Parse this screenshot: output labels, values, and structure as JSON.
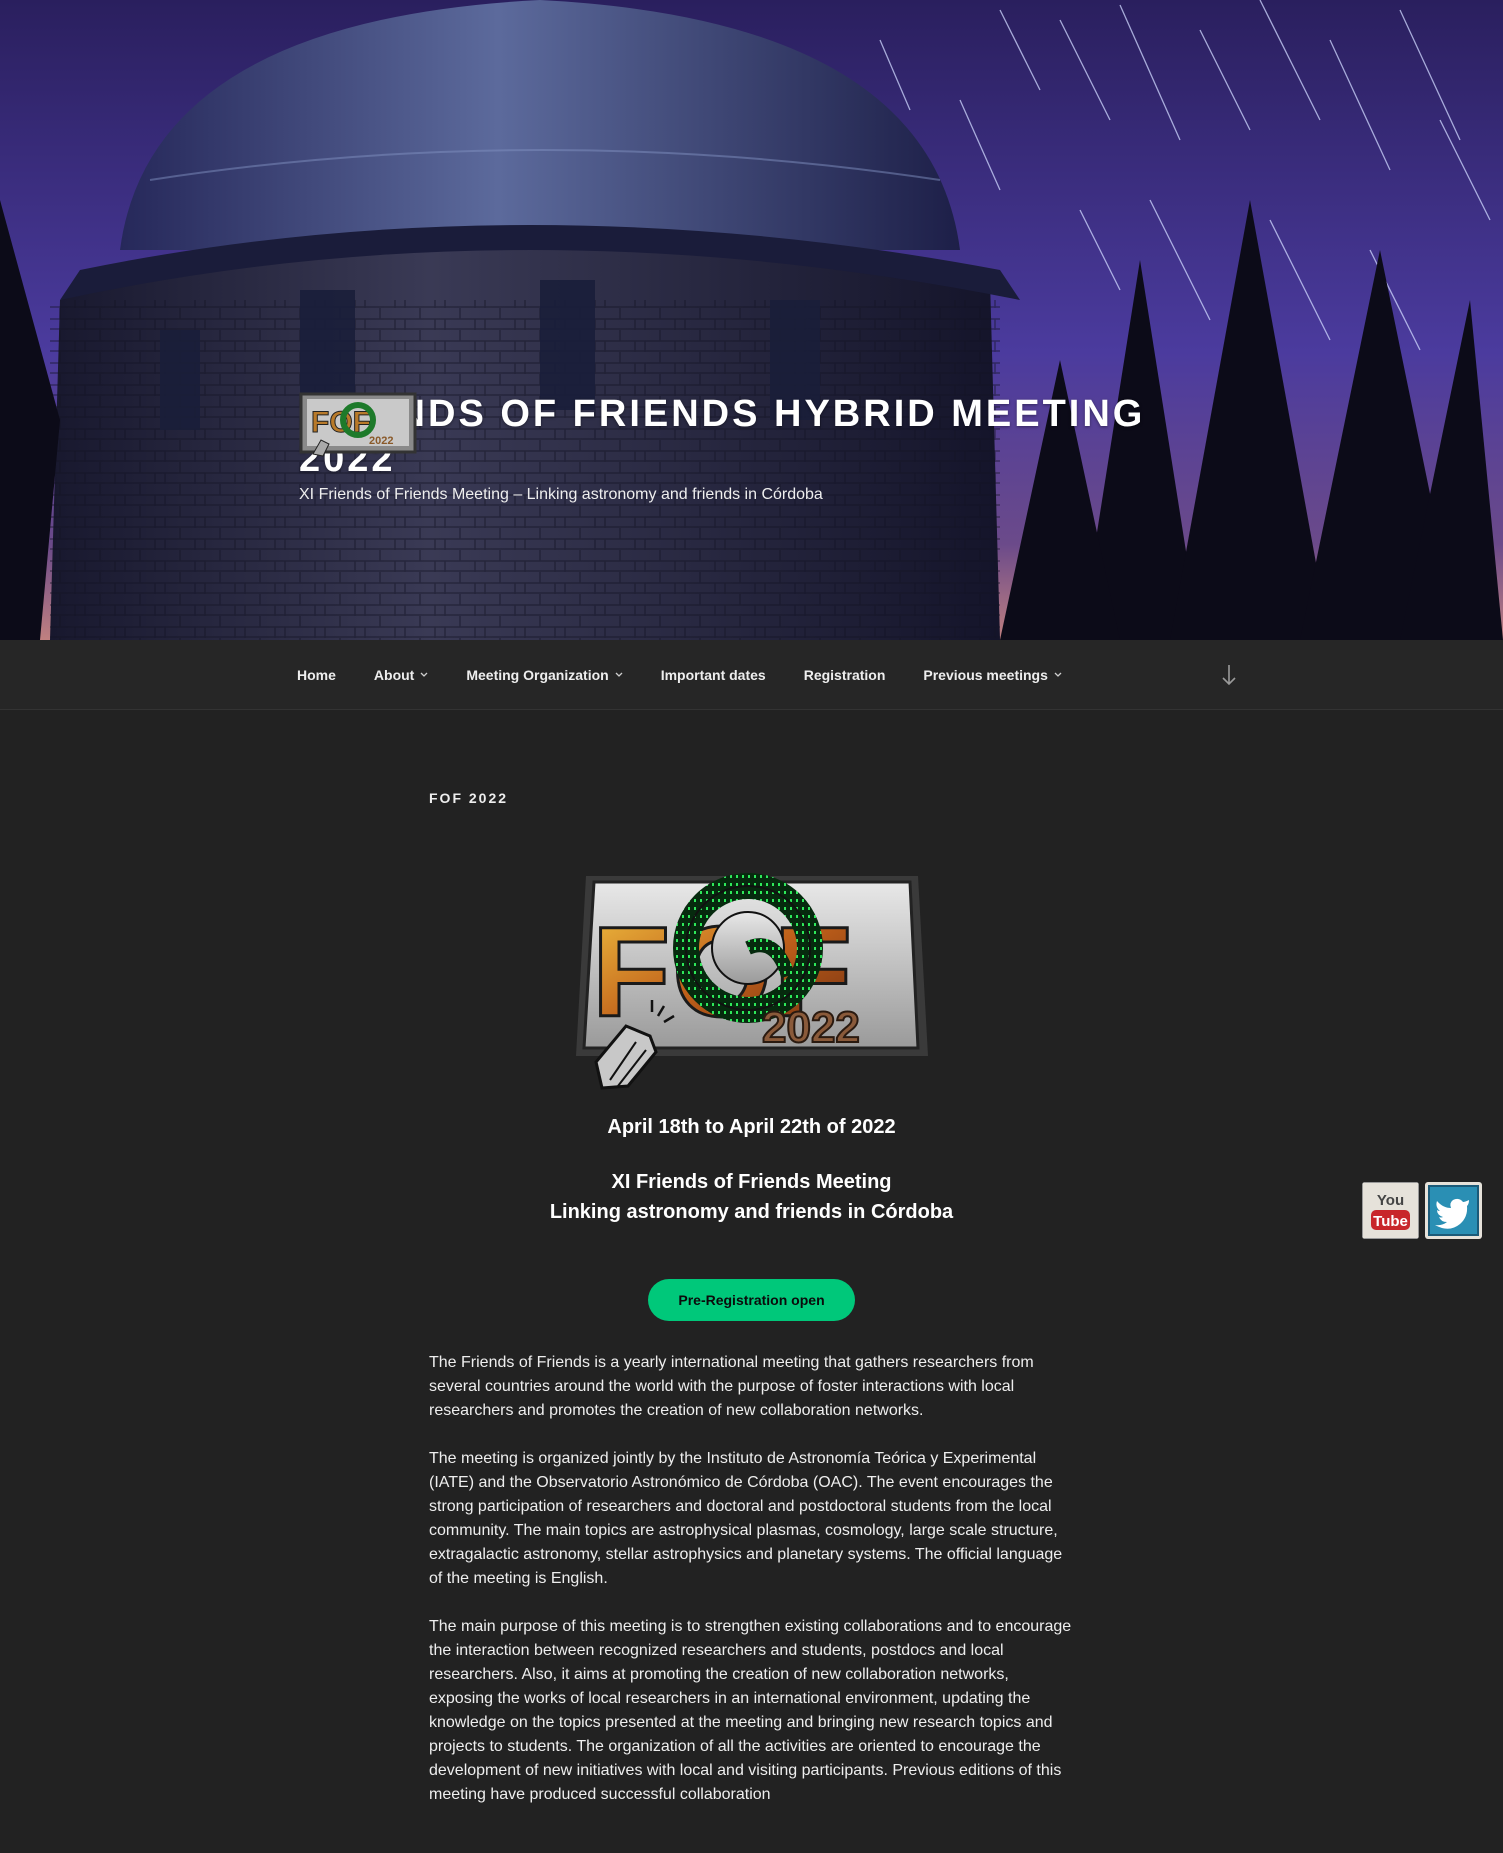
{
  "site": {
    "title": "FRIENDS OF FRIENDS HYBRID MEETING 2022",
    "description": "XI Friends of Friends Meeting – Linking astronomy and friends in Córdoba",
    "logo_text": "FOF",
    "logo_year": "2022"
  },
  "nav": {
    "items": [
      {
        "label": "Home",
        "has_submenu": false
      },
      {
        "label": "About",
        "has_submenu": true
      },
      {
        "label": "Meeting Organization",
        "has_submenu": true
      },
      {
        "label": "Important dates",
        "has_submenu": false
      },
      {
        "label": "Registration",
        "has_submenu": false
      },
      {
        "label": "Previous meetings",
        "has_submenu": true
      }
    ],
    "scroll_icon": "arrow-down-icon"
  },
  "main": {
    "page_title": "FOF 2022",
    "logo_text": "FOF",
    "logo_year": "2022",
    "date_line": "April 18th to April 22th of 2022",
    "meeting_line_1": "XI Friends of Friends Meeting",
    "meeting_line_2": "Linking astronomy and friends in Córdoba",
    "button_label": "Pre-Registration open",
    "paragraphs": [
      "The Friends of Friends is a yearly international meeting that gathers researchers from several countries around the world with the purpose of foster interactions with local researchers and promotes the creation of new collaboration networks.",
      "The meeting is organized jointly by the Instituto de Astronomía Teórica y Experimental (IATE) and the Observatorio Astronómico de Córdoba (OAC). The event encourages the strong participation of researchers and doctoral and postdoctoral students from the local community. The main topics are astrophysical plasmas, cosmology, large scale structure, extragalactic astronomy, stellar astrophysics and planetary systems. The official language of the meeting is English.",
      "The main purpose of this meeting is to strengthen existing collaborations and to encourage the interaction between recognized researchers and students, postdocs and local researchers. Also, it aims at promoting the creation of new collaboration networks, exposing the works of local researchers in an international environment, updating the knowledge on the topics presented at the meeting and bringing new research topics and projects to students. The organization of all the activities are oriented to encourage the development of new initiatives with local and visiting participants.  Previous editions of this meeting have produced successful collaboration"
    ]
  },
  "social": {
    "youtube_top": "You",
    "youtube_bottom": "Tube",
    "youtube_icon": "youtube-icon",
    "twitter_icon": "twitter-icon"
  },
  "colors": {
    "background": "#222222",
    "nav_background": "#262626",
    "accent_button": "#00c87a",
    "text": "#eeeeee"
  }
}
